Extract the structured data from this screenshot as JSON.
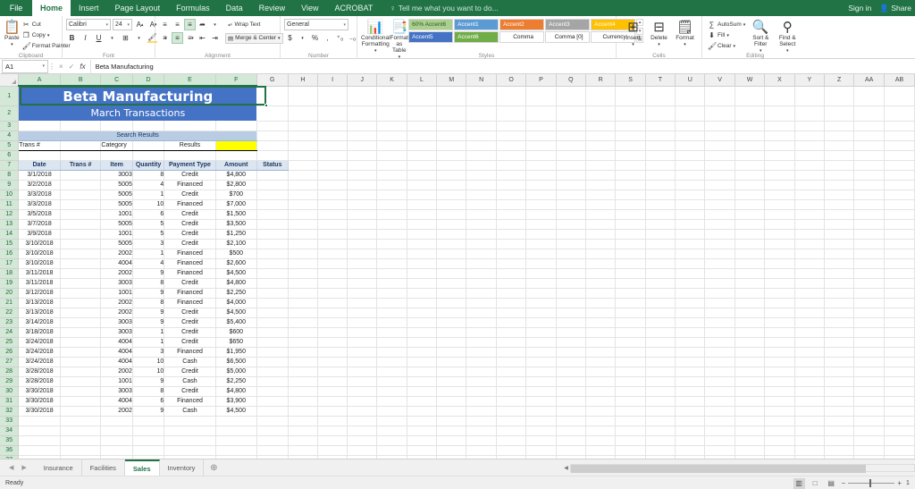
{
  "app": {
    "ribbon_tabs": [
      "File",
      "Home",
      "Insert",
      "Page Layout",
      "Formulas",
      "Data",
      "Review",
      "View",
      "ACROBAT"
    ],
    "active_ribbon_tab": "Home",
    "tell_me": "Tell me what you want to do...",
    "sign_in": "Sign in",
    "share": "Share",
    "accent_color": "#217346"
  },
  "ribbon": {
    "clipboard": {
      "label": "Clipboard",
      "paste": "Paste",
      "cut": "Cut",
      "copy": "Copy",
      "format_painter": "Format Painter"
    },
    "font": {
      "label": "Font",
      "font_name": "Calibri",
      "font_size": "24",
      "grow": "A",
      "shrink": "A",
      "bold": "B",
      "italic": "I",
      "underline": "U"
    },
    "alignment": {
      "label": "Alignment",
      "wrap_text": "Wrap Text",
      "merge_center": "Merge & Center"
    },
    "number": {
      "label": "Number",
      "format": "General",
      "currency": "$",
      "percent": "%",
      "comma": ","
    },
    "styles": {
      "label": "Styles",
      "conditional_formatting": "Conditional Formatting",
      "format_as_table": "Format as Table",
      "gallery": [
        {
          "name": "60%   Accent6",
          "bg": "#a9d08e",
          "fg": "#375623"
        },
        {
          "name": "Accent1",
          "bg": "#5b9bd5",
          "fg": "#ffffff"
        },
        {
          "name": "Accent2",
          "bg": "#ed7d31",
          "fg": "#ffffff"
        },
        {
          "name": "Accent3",
          "bg": "#a5a5a5",
          "fg": "#ffffff"
        },
        {
          "name": "Accent4",
          "bg": "#ffc000",
          "fg": "#ffffff"
        },
        {
          "name": "Accent5",
          "bg": "#4472c4",
          "fg": "#ffffff"
        },
        {
          "name": "Accent6",
          "bg": "#70ad47",
          "fg": "#ffffff"
        },
        {
          "name": "Comma",
          "bg": "#ffffff",
          "fg": "#222222"
        },
        {
          "name": "Comma [0]",
          "bg": "#ffffff",
          "fg": "#222222"
        },
        {
          "name": "Currency",
          "bg": "#ffffff",
          "fg": "#222222"
        }
      ]
    },
    "cells": {
      "label": "Cells",
      "insert": "Insert",
      "delete": "Delete",
      "format": "Format"
    },
    "editing": {
      "label": "Editing",
      "autosum": "AutoSum",
      "fill": "Fill",
      "clear": "Clear",
      "sort_filter": "Sort & Filter",
      "find_select": "Find & Select"
    }
  },
  "formula_bar": {
    "name_box": "A1",
    "formula": "Beta Manufacturing",
    "cancel_icon": "×",
    "confirm_icon": "✓",
    "fx_icon": "fx"
  },
  "sheet": {
    "columns": [
      "A",
      "B",
      "C",
      "D",
      "E",
      "F",
      "G",
      "H",
      "I",
      "J",
      "K",
      "L",
      "M",
      "N",
      "O",
      "P",
      "Q",
      "R",
      "S",
      "T",
      "U",
      "V",
      "W",
      "X",
      "Y",
      "Z",
      "AA",
      "AB"
    ],
    "selected_columns": [
      "A",
      "B",
      "C",
      "D",
      "E",
      "F"
    ],
    "title": "Beta Manufacturing",
    "subtitle": "March Transactions",
    "search_results_label": "Search Results",
    "search_row": {
      "trans_label": "Trans #",
      "category_label": "Category",
      "results_label": "Results",
      "result_value": ""
    },
    "headers": [
      "Date",
      "Trans #",
      "Item",
      "Quantity",
      "Payment Type",
      "Amount",
      "Status"
    ],
    "rows": [
      {
        "date": "3/1/2018",
        "trans": "",
        "item": "3003",
        "qty": "8",
        "payment": "Credit",
        "amount": "$4,800",
        "status": ""
      },
      {
        "date": "3/2/2018",
        "trans": "",
        "item": "5005",
        "qty": "4",
        "payment": "Financed",
        "amount": "$2,800",
        "status": ""
      },
      {
        "date": "3/3/2018",
        "trans": "",
        "item": "5005",
        "qty": "1",
        "payment": "Credit",
        "amount": "$700",
        "status": ""
      },
      {
        "date": "3/3/2018",
        "trans": "",
        "item": "5005",
        "qty": "10",
        "payment": "Financed",
        "amount": "$7,000",
        "status": ""
      },
      {
        "date": "3/5/2018",
        "trans": "",
        "item": "1001",
        "qty": "6",
        "payment": "Credit",
        "amount": "$1,500",
        "status": ""
      },
      {
        "date": "3/7/2018",
        "trans": "",
        "item": "5005",
        "qty": "5",
        "payment": "Credit",
        "amount": "$3,500",
        "status": ""
      },
      {
        "date": "3/9/2018",
        "trans": "",
        "item": "1001",
        "qty": "5",
        "payment": "Credit",
        "amount": "$1,250",
        "status": ""
      },
      {
        "date": "3/10/2018",
        "trans": "",
        "item": "5005",
        "qty": "3",
        "payment": "Credit",
        "amount": "$2,100",
        "status": ""
      },
      {
        "date": "3/10/2018",
        "trans": "",
        "item": "2002",
        "qty": "1",
        "payment": "Financed",
        "amount": "$500",
        "status": ""
      },
      {
        "date": "3/10/2018",
        "trans": "",
        "item": "4004",
        "qty": "4",
        "payment": "Financed",
        "amount": "$2,600",
        "status": ""
      },
      {
        "date": "3/11/2018",
        "trans": "",
        "item": "2002",
        "qty": "9",
        "payment": "Financed",
        "amount": "$4,500",
        "status": ""
      },
      {
        "date": "3/11/2018",
        "trans": "",
        "item": "3003",
        "qty": "8",
        "payment": "Credit",
        "amount": "$4,800",
        "status": ""
      },
      {
        "date": "3/12/2018",
        "trans": "",
        "item": "1001",
        "qty": "9",
        "payment": "Financed",
        "amount": "$2,250",
        "status": ""
      },
      {
        "date": "3/13/2018",
        "trans": "",
        "item": "2002",
        "qty": "8",
        "payment": "Financed",
        "amount": "$4,000",
        "status": ""
      },
      {
        "date": "3/13/2018",
        "trans": "",
        "item": "2002",
        "qty": "9",
        "payment": "Credit",
        "amount": "$4,500",
        "status": ""
      },
      {
        "date": "3/14/2018",
        "trans": "",
        "item": "3003",
        "qty": "9",
        "payment": "Credit",
        "amount": "$5,400",
        "status": ""
      },
      {
        "date": "3/18/2018",
        "trans": "",
        "item": "3003",
        "qty": "1",
        "payment": "Credit",
        "amount": "$600",
        "status": ""
      },
      {
        "date": "3/24/2018",
        "trans": "",
        "item": "4004",
        "qty": "1",
        "payment": "Credit",
        "amount": "$650",
        "status": ""
      },
      {
        "date": "3/24/2018",
        "trans": "",
        "item": "4004",
        "qty": "3",
        "payment": "Financed",
        "amount": "$1,950",
        "status": ""
      },
      {
        "date": "3/24/2018",
        "trans": "",
        "item": "4004",
        "qty": "10",
        "payment": "Cash",
        "amount": "$6,500",
        "status": ""
      },
      {
        "date": "3/28/2018",
        "trans": "",
        "item": "2002",
        "qty": "10",
        "payment": "Credit",
        "amount": "$5,000",
        "status": ""
      },
      {
        "date": "3/28/2018",
        "trans": "",
        "item": "1001",
        "qty": "9",
        "payment": "Cash",
        "amount": "$2,250",
        "status": ""
      },
      {
        "date": "3/30/2018",
        "trans": "",
        "item": "3003",
        "qty": "8",
        "payment": "Credit",
        "amount": "$4,800",
        "status": ""
      },
      {
        "date": "3/30/2018",
        "trans": "",
        "item": "4004",
        "qty": "6",
        "payment": "Financed",
        "amount": "$3,900",
        "status": ""
      },
      {
        "date": "3/30/2018",
        "trans": "",
        "item": "2002",
        "qty": "9",
        "payment": "Cash",
        "amount": "$4,500",
        "status": ""
      }
    ],
    "title_bg": "#4472c4",
    "header_bg": "#dce6f1",
    "search_bg": "#b8cce4",
    "highlight_bg": "#ffff00"
  },
  "sheet_tabs": {
    "tabs": [
      "Insurance",
      "Facilities",
      "Sales",
      "Inventory"
    ],
    "active": "Sales",
    "add_label": "+"
  },
  "status_bar": {
    "message": "Ready",
    "zoom": "1"
  }
}
